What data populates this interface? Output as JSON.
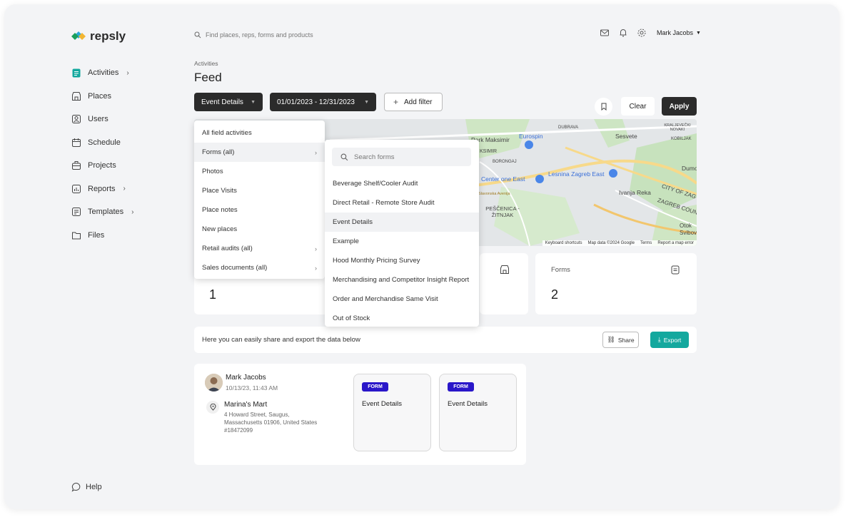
{
  "brand": {
    "name": "repsly"
  },
  "search": {
    "placeholder": "Find places, reps, forms and products"
  },
  "user": {
    "name": "Mark Jacobs"
  },
  "sidebar": {
    "items": [
      {
        "label": "Activities",
        "icon": "clipboard-icon",
        "has_chevron": true
      },
      {
        "label": "Places",
        "icon": "store-icon",
        "has_chevron": false
      },
      {
        "label": "Users",
        "icon": "user-icon",
        "has_chevron": false
      },
      {
        "label": "Schedule",
        "icon": "calendar-icon",
        "has_chevron": false
      },
      {
        "label": "Projects",
        "icon": "briefcase-icon",
        "has_chevron": false
      },
      {
        "label": "Reports",
        "icon": "chart-icon",
        "has_chevron": true
      },
      {
        "label": "Templates",
        "icon": "template-icon",
        "has_chevron": true
      },
      {
        "label": "Files",
        "icon": "folder-icon",
        "has_chevron": false
      }
    ],
    "help": "Help"
  },
  "header": {
    "breadcrumb": "Activities",
    "title": "Feed"
  },
  "filters": {
    "type_label": "Event Details",
    "date_label": "01/01/2023 - 12/31/2023",
    "add_filter": "Add filter",
    "clear": "Clear",
    "apply": "Apply"
  },
  "map": {
    "labels": [
      "Park Maksimir",
      "Eurospin",
      "DUBRAVA",
      "Sesvete",
      "KRALJEVEČKI NOVAKI",
      "KOBILJAK",
      "KSIMIR",
      "BORONGAJ",
      "Dumov",
      "Center one East",
      "Lesnina Zagreb East",
      "Ivanja Reka",
      "CITY OF ZAG",
      "ZAGREB COUN",
      "PEŠČENICA - ŽITNJAK",
      "Otok Svibov",
      "Slavonska Avenija"
    ],
    "footer": [
      "Keyboard shortcuts",
      "Map data ©2024 Google",
      "Terms",
      "Report a map error"
    ]
  },
  "stats": [
    {
      "label": "",
      "value": "1"
    },
    {
      "label": "Forms",
      "value": "2"
    }
  ],
  "share": {
    "text": "Here you can easily share and export the data below",
    "share": "Share",
    "export": "Export"
  },
  "feed": {
    "user": "Mark Jacobs",
    "datetime": "10/13/23, 11:43 AM",
    "place": "Marina's Mart",
    "address": "4 Howard Street, Saugus, Massachusetts 01906, United States",
    "place_id": "#18472099",
    "cards": [
      {
        "badge": "FORM",
        "title": "Event Details"
      },
      {
        "badge": "FORM",
        "title": "Event Details"
      }
    ]
  },
  "activity_menu": [
    {
      "label": "All field activities",
      "arrow": false
    },
    {
      "label": "Forms (all)",
      "arrow": true
    },
    {
      "label": "Photos",
      "arrow": false
    },
    {
      "label": "Place Visits",
      "arrow": false
    },
    {
      "label": "Place notes",
      "arrow": false
    },
    {
      "label": "New places",
      "arrow": false
    },
    {
      "label": "Retail audits (all)",
      "arrow": true
    },
    {
      "label": "Sales documents (all)",
      "arrow": true
    }
  ],
  "forms_menu": {
    "search_placeholder": "Search forms",
    "items": [
      "Beverage Shelf/Cooler Audit",
      "Direct Retail - Remote Store Audit",
      "Event Details",
      "Example",
      "Hood Monthly Pricing Survey",
      "Merchandising and Competitor Insight Report",
      "Order and Merchandise Same Visit",
      "Out of Stock"
    ]
  },
  "colors": {
    "accent": "#13a89e",
    "dark": "#2b2b2b",
    "badge": "#2a17c9"
  }
}
